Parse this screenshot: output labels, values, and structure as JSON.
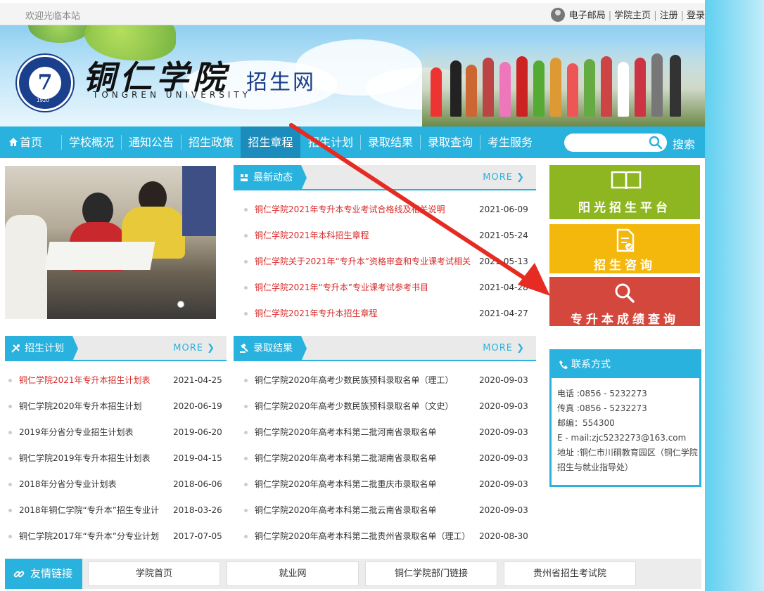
{
  "topbar": {
    "welcome": "欢迎光临本站",
    "links": [
      "电子邮局",
      "学院主页",
      "注册",
      "登录"
    ]
  },
  "banner": {
    "school_cn": "铜仁学院",
    "school_en": "TONGREN UNIVERSITY",
    "site_name": "招生网",
    "logo_year": "1920"
  },
  "nav": {
    "items": [
      "首页",
      "学校概况",
      "通知公告",
      "招生政策",
      "招生章程",
      "招生计划",
      "录取结果",
      "录取查询",
      "考生服务"
    ],
    "active_index": 4,
    "search_label": "搜索"
  },
  "news": {
    "title": "最新动态",
    "more": "MORE",
    "items": [
      {
        "title": "铜仁学院2021年专升本专业考试合格线及相关说明",
        "date": "2021-06-09"
      },
      {
        "title": "铜仁学院2021年本科招生章程",
        "date": "2021-05-24"
      },
      {
        "title": "铜仁学院关于2021年“专升本”资格审查和专业课考试相关",
        "date": "2021-05-13"
      },
      {
        "title": "铜仁学院2021年“专升本”专业课考试参考书目",
        "date": "2021-04-28"
      },
      {
        "title": "铜仁学院2021年专升本招生章程",
        "date": "2021-04-27"
      }
    ]
  },
  "plan": {
    "title": "招生计划",
    "more": "MORE",
    "items": [
      {
        "title": "铜仁学院2021年专升本招生计划表",
        "date": "2021-04-25",
        "red": true
      },
      {
        "title": "铜仁学院2020年专升本招生计划",
        "date": "2020-06-19",
        "red": false
      },
      {
        "title": "2019年分省分专业招生计划表",
        "date": "2019-06-20",
        "red": false
      },
      {
        "title": "铜仁学院2019年专升本招生计划表",
        "date": "2019-04-15",
        "red": false
      },
      {
        "title": "2018年分省分专业计划表",
        "date": "2018-06-06",
        "red": false
      },
      {
        "title": "2018年铜仁学院“专升本”招生专业计",
        "date": "2018-03-26",
        "red": false
      },
      {
        "title": "铜仁学院2017年“专升本”分专业计划",
        "date": "2017-07-05",
        "red": false
      }
    ]
  },
  "results": {
    "title": "录取结果",
    "more": "MORE",
    "items": [
      {
        "title": "铜仁学院2020年高考少数民族预科录取名单（理工）",
        "date": "2020-09-03"
      },
      {
        "title": "铜仁学院2020年高考少数民族预科录取名单（文史）",
        "date": "2020-09-03"
      },
      {
        "title": "铜仁学院2020年高考本科第二批河南省录取名单",
        "date": "2020-09-03"
      },
      {
        "title": "铜仁学院2020年高考本科第二批湖南省录取名单",
        "date": "2020-09-03"
      },
      {
        "title": "铜仁学院2020年高考本科第二批重庆市录取名单",
        "date": "2020-09-03"
      },
      {
        "title": "铜仁学院2020年高考本科第二批云南省录取名单",
        "date": "2020-09-03"
      },
      {
        "title": "铜仁学院2020年高考本科第二批贵州省录取名单（理工）",
        "date": "2020-08-30"
      }
    ]
  },
  "tiles": [
    {
      "label": "阳光招生平台",
      "color": "#8db620",
      "icon": "book-icon"
    },
    {
      "label": "招生咨询",
      "color": "#f4b80d",
      "icon": "document-icon"
    },
    {
      "label": "专升本成绩查询",
      "color": "#d4473c",
      "icon": "search-icon"
    }
  ],
  "contact": {
    "title": "联系方式",
    "lines": [
      "电话 :0856 - 5232273",
      "传真 :0856 - 5232273",
      "邮编：554300",
      "E - mail:zjc5232273@163.com",
      "地址 :铜仁市川硐教育园区（铜仁学院",
      "招生与就业指导处）"
    ]
  },
  "friends": {
    "title": "友情链接",
    "links": [
      "学院首页",
      "就业网",
      "铜仁学院部门链接",
      "贵州省招生考试院"
    ]
  },
  "colors": {
    "accent": "#2ab2de",
    "nav_active": "#1b8cbc",
    "red_text": "#d72a2a",
    "annotation_arrow": "#e52b22"
  }
}
